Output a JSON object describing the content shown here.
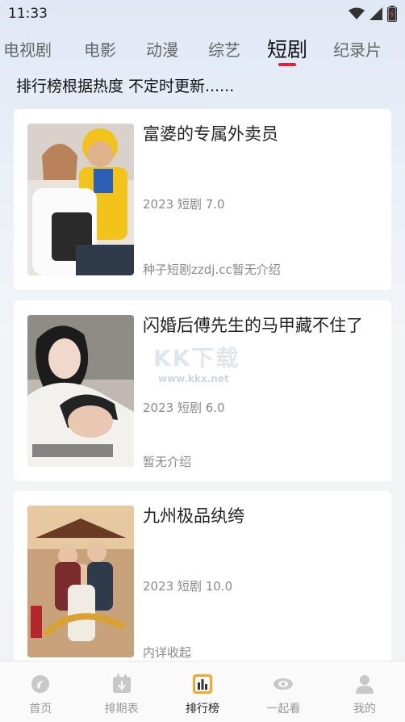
{
  "status_bar": {
    "time": "11:33",
    "icons": [
      "wifi-icon",
      "signal-icon",
      "battery-icon"
    ]
  },
  "tabs": [
    {
      "label": "电视剧",
      "active": false
    },
    {
      "label": "电影",
      "active": false
    },
    {
      "label": "动漫",
      "active": false
    },
    {
      "label": "综艺",
      "active": false
    },
    {
      "label": "短剧",
      "active": true
    },
    {
      "label": "纪录片",
      "active": false
    }
  ],
  "subtitle": "排行榜根据热度 不定时更新......",
  "items": [
    {
      "title": "富婆的专属外卖员",
      "meta": "2023 短剧 7.0",
      "desc": "种子短剧zzdj.cc暂无介绍"
    },
    {
      "title": "闪婚后傅先生的马甲藏不住了",
      "meta": "2023 短剧 6.0",
      "desc": "暂无介绍"
    },
    {
      "title": "九州极品纨绔",
      "meta": "2023 短剧 10.0",
      "desc": "内详收起"
    }
  ],
  "watermark": {
    "main": "KK下载",
    "sub": "www.kkx.net"
  },
  "bottom_nav": [
    {
      "label": "首页",
      "icon": "home-icon",
      "active": false
    },
    {
      "label": "排期表",
      "icon": "calendar-icon",
      "active": false
    },
    {
      "label": "排行榜",
      "icon": "ranking-icon",
      "active": true
    },
    {
      "label": "一起看",
      "icon": "eye-icon",
      "active": false
    },
    {
      "label": "我的",
      "icon": "user-icon",
      "active": false
    }
  ],
  "colors": {
    "accent": "#d6263b",
    "ranking_icon": "#f5a623"
  }
}
